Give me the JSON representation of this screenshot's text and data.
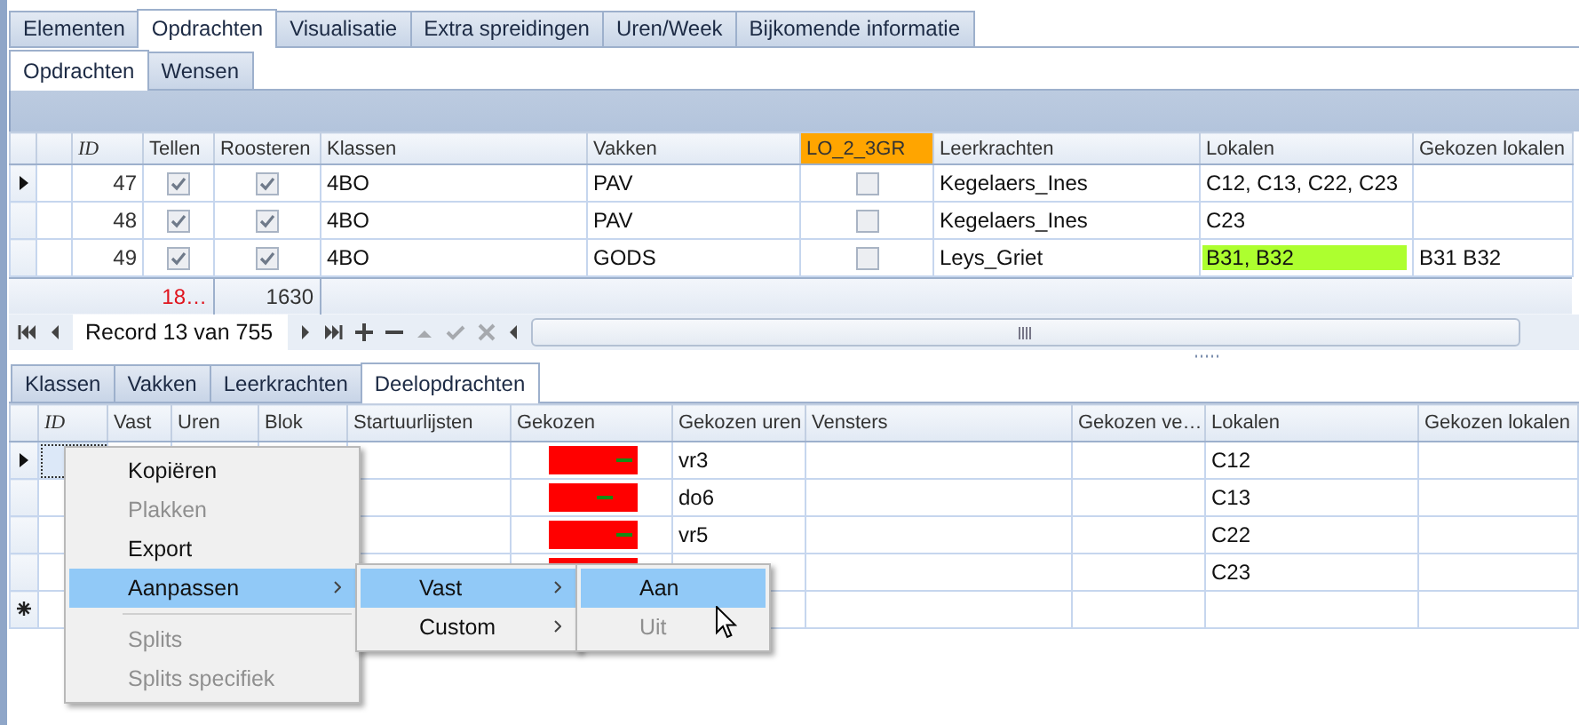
{
  "main_tabs": [
    {
      "label": "Elementen",
      "selected": false
    },
    {
      "label": "Opdrachten",
      "selected": true
    },
    {
      "label": "Visualisatie",
      "selected": false
    },
    {
      "label": "Extra spreidingen",
      "selected": false
    },
    {
      "label": "Uren/Week",
      "selected": false
    },
    {
      "label": "Bijkomende informatie",
      "selected": false
    }
  ],
  "sub_tabs": [
    {
      "label": "Opdrachten",
      "selected": true
    },
    {
      "label": "Wensen",
      "selected": false
    }
  ],
  "upper_grid": {
    "columns": [
      {
        "label": "ID",
        "kind": "number"
      },
      {
        "label": "Tellen",
        "kind": "check",
        "summary": "18…",
        "summary_alert": true
      },
      {
        "label": "Roosteren",
        "kind": "check",
        "summary": "1630",
        "summary_alert": false
      },
      {
        "label": "Klassen",
        "kind": "text"
      },
      {
        "label": "Vakken",
        "kind": "text"
      },
      {
        "label": "LO_2_3GR",
        "kind": "check",
        "highlighted": true
      },
      {
        "label": "Leerkrachten",
        "kind": "text"
      },
      {
        "label": "Lokalen",
        "kind": "text"
      },
      {
        "label": "Gekozen lokalen",
        "kind": "text"
      }
    ],
    "rows": [
      {
        "selected": true,
        "cells": [
          "47",
          true,
          true,
          "4BO",
          "PAV",
          false,
          "Kegelaers_Ines",
          {
            "text": "C12, C13, C22, C23",
            "highlighted": false
          },
          null
        ]
      },
      {
        "selected": false,
        "cells": [
          "48",
          true,
          true,
          "4BO",
          "PAV",
          false,
          "Kegelaers_Ines",
          {
            "text": "C23",
            "highlighted": false
          },
          null
        ]
      },
      {
        "selected": false,
        "cells": [
          "49",
          true,
          true,
          "4BO",
          "GODS",
          false,
          "Leys_Griet",
          {
            "text": "B31, B32",
            "highlighted": true
          },
          "B31 B32"
        ]
      }
    ]
  },
  "navigator": {
    "record": "Record 13 van 755",
    "buttons": [
      {
        "kind": "first",
        "disabled": false
      },
      {
        "kind": "prev",
        "disabled": false
      },
      {
        "kind": "record"
      },
      {
        "kind": "next",
        "disabled": false
      },
      {
        "kind": "last",
        "disabled": false
      },
      {
        "kind": "add",
        "disabled": false
      },
      {
        "kind": "remove",
        "disabled": false
      },
      {
        "kind": "up",
        "disabled": true
      },
      {
        "kind": "save",
        "disabled": true
      },
      {
        "kind": "cancel",
        "disabled": true
      }
    ]
  },
  "lower_tabs": [
    {
      "label": "Klassen",
      "selected": false
    },
    {
      "label": "Vakken",
      "selected": false
    },
    {
      "label": "Leerkrachten",
      "selected": false
    },
    {
      "label": "Deelopdrachten",
      "selected": true
    }
  ],
  "lower_grid": {
    "columns": [
      {
        "label": "ID",
        "kind": "number"
      },
      {
        "label": "Vast",
        "kind": "text"
      },
      {
        "label": "Uren",
        "kind": "text"
      },
      {
        "label": "Blok",
        "kind": "text"
      },
      {
        "label": "Startuurlijsten",
        "kind": "text"
      },
      {
        "label": "Gekozen",
        "kind": "bar"
      },
      {
        "label": "Gekozen uren",
        "kind": "text"
      },
      {
        "label": "Vensters",
        "kind": "text"
      },
      {
        "label": "Gekozen ve…",
        "kind": "text"
      },
      {
        "label": "Lokalen",
        "kind": "text"
      },
      {
        "label": "Gekozen lokalen",
        "kind": "text"
      }
    ],
    "rows": [
      {
        "kind": "data",
        "selected": true,
        "cells": [
          null,
          null,
          null,
          null,
          null,
          {
            "level": 0.85
          },
          "vr3",
          null,
          null,
          "C12",
          null
        ]
      },
      {
        "kind": "data",
        "selected": false,
        "cells": [
          null,
          null,
          null,
          null,
          null,
          {
            "level": 0.62
          },
          "do6",
          null,
          null,
          "C13",
          null
        ]
      },
      {
        "kind": "data",
        "selected": false,
        "cells": [
          null,
          null,
          null,
          null,
          null,
          {
            "level": 0.85
          },
          "vr5",
          null,
          null,
          "C22",
          null
        ]
      },
      {
        "kind": "data",
        "selected": false,
        "cells": [
          null,
          null,
          null,
          null,
          null,
          {},
          null,
          null,
          null,
          "C23",
          null
        ]
      },
      {
        "kind": "new",
        "cells": [
          null,
          null,
          null,
          null,
          null,
          null,
          null,
          null,
          null,
          null,
          null
        ]
      }
    ]
  },
  "context_menu": {
    "items": [
      {
        "kind": "item",
        "label": "Kopiëren",
        "disabled": false,
        "highlighted": false
      },
      {
        "kind": "item",
        "label": "Plakken",
        "disabled": true,
        "highlighted": false
      },
      {
        "kind": "item",
        "label": "Export",
        "disabled": false,
        "highlighted": false
      },
      {
        "kind": "item",
        "label": "Aanpassen",
        "disabled": false,
        "highlighted": true,
        "expanded": true,
        "children": [
          {
            "kind": "item",
            "label": "Vast",
            "disabled": false,
            "highlighted": true,
            "expanded": true,
            "children": [
              {
                "kind": "item",
                "label": "Aan",
                "disabled": false,
                "highlighted": true
              },
              {
                "kind": "item",
                "label": "Uit",
                "disabled": true,
                "highlighted": false
              }
            ]
          },
          {
            "kind": "item",
            "label": "Custom",
            "disabled": false,
            "highlighted": false,
            "has_submenu": true
          }
        ]
      },
      {
        "kind": "separator"
      },
      {
        "kind": "item",
        "label": "Splits",
        "disabled": true,
        "highlighted": false
      },
      {
        "kind": "item",
        "label": "Splits specifiek",
        "disabled": true,
        "highlighted": false
      }
    ]
  }
}
